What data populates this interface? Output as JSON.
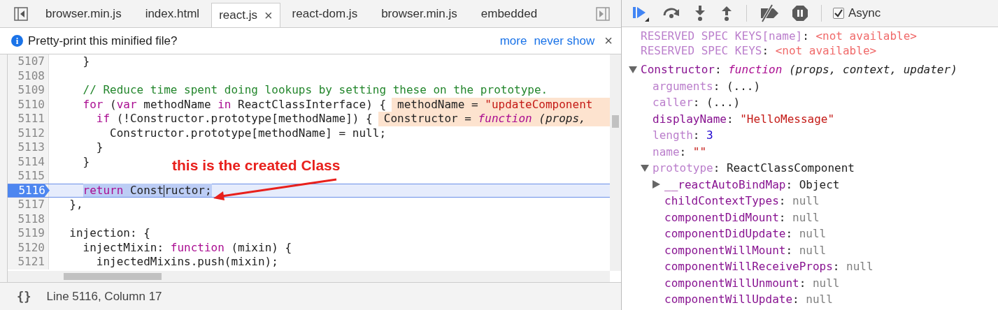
{
  "tabs": [
    {
      "label": "browser.min.js",
      "selected": false
    },
    {
      "label": "index.html",
      "selected": false
    },
    {
      "label": "react.js",
      "selected": true,
      "close": "×"
    },
    {
      "label": "react-dom.js",
      "selected": false
    },
    {
      "label": "browser.min.js",
      "selected": false
    },
    {
      "label": "embedded",
      "selected": false
    }
  ],
  "infobar": {
    "icon": "i",
    "message": "Pretty-print this minified file?",
    "links": [
      "more",
      "never show"
    ],
    "close": "×"
  },
  "code": {
    "lines": [
      {
        "number": "5107",
        "current": false,
        "tokens": [
          {
            "kind": "plain",
            "text": "    }"
          }
        ]
      },
      {
        "number": "5108",
        "current": false
      },
      {
        "number": "5109",
        "current": false,
        "tokens": [
          {
            "kind": "comment",
            "text": "    // Reduce time spent doing lookups by setting these on the prototype."
          }
        ]
      },
      {
        "number": "5110",
        "current": false,
        "tokens": [
          {
            "kind": "keyword",
            "text": "    for"
          },
          {
            "kind": "plain",
            "text": " ("
          },
          {
            "kind": "keyword",
            "text": "var"
          },
          {
            "kind": "plain",
            "text": " methodName "
          },
          {
            "kind": "keyword",
            "text": "in"
          },
          {
            "kind": "plain",
            "text": " ReactClassInterface) {"
          }
        ],
        "inline_value": [
          {
            "kind": "plain",
            "text": "methodName = "
          },
          {
            "kind": "string",
            "text": "\"updateComponent"
          }
        ]
      },
      {
        "number": "5111",
        "current": false,
        "tokens": [
          {
            "kind": "keyword",
            "text": "      if"
          },
          {
            "kind": "plain",
            "text": " (!Constructor.prototype[methodName]) {"
          }
        ],
        "inline_value": [
          {
            "kind": "plain",
            "text": "Constructor = "
          },
          {
            "kind": "fn",
            "text": "function"
          },
          {
            "kind": "params",
            "text": " (props,"
          }
        ]
      },
      {
        "number": "5112",
        "current": false,
        "tokens": [
          {
            "kind": "plain",
            "text": "        Constructor.prototype[methodName] = null;"
          }
        ]
      },
      {
        "number": "5113",
        "current": false,
        "tokens": [
          {
            "kind": "plain",
            "text": "      }"
          }
        ]
      },
      {
        "number": "5114",
        "current": false,
        "tokens": [
          {
            "kind": "plain",
            "text": "    }"
          }
        ]
      },
      {
        "number": "5115",
        "current": false
      },
      {
        "number": "5116",
        "current": true,
        "selection": [
          {
            "kind": "keyword",
            "text": "    return"
          },
          {
            "kind": "plain",
            "text": " Const"
          },
          {
            "kind": "caret"
          },
          {
            "kind": "plain",
            "text": "ructor;"
          }
        ]
      },
      {
        "number": "5117",
        "current": false,
        "tokens": [
          {
            "kind": "plain",
            "text": "  },"
          }
        ]
      },
      {
        "number": "5118",
        "current": false
      },
      {
        "number": "5119",
        "current": false,
        "tokens": [
          {
            "kind": "plain",
            "text": "  injection: {"
          }
        ]
      },
      {
        "number": "5120",
        "current": false,
        "tokens": [
          {
            "kind": "plain",
            "text": "    injectMixin: "
          },
          {
            "kind": "keyword",
            "text": "function"
          },
          {
            "kind": "plain",
            "text": " (mixin) {"
          }
        ]
      },
      {
        "number": "5121",
        "current": false,
        "tokens": [
          {
            "kind": "plain",
            "text": "      injectedMixins.push(mixin);"
          }
        ]
      }
    ],
    "callout": {
      "text": "this is the created Class"
    }
  },
  "status_bar": {
    "format_icon": "{}",
    "position": "Line 5116, Column 17"
  },
  "toolbar": {
    "async": {
      "label": "Async",
      "checked": true
    }
  },
  "scope": [
    {
      "name": "RESERVED SPEC KEYS[name]",
      "sep": ":",
      "dimmed": true,
      "kind": "unavailable",
      "value": "<not available>"
    },
    {
      "name": "RESERVED SPEC KEYS",
      "sep": ":",
      "dimmed": true,
      "kind": "unavailable",
      "value": "<not available>"
    },
    {
      "name": "Constructor",
      "sep": ":",
      "dimmed": false,
      "kind": "function",
      "keyword": "function",
      "value": "(props, context, updater)",
      "expanded": true,
      "children": [
        {
          "name": "arguments",
          "sep": ":",
          "dimmed": true,
          "kind": "plain",
          "value": "(...)"
        },
        {
          "name": "caller",
          "sep": ":",
          "dimmed": true,
          "kind": "plain",
          "value": "(...)"
        },
        {
          "name": "displayName",
          "sep": ":",
          "dimmed": false,
          "kind": "string",
          "value": "\"HelloMessage\""
        },
        {
          "name": "length",
          "sep": ":",
          "dimmed": true,
          "kind": "number",
          "value": "3"
        },
        {
          "name": "name",
          "sep": ":",
          "dimmed": true,
          "kind": "string",
          "value": "\"\""
        },
        {
          "name": "prototype",
          "sep": ":",
          "dimmed": true,
          "kind": "plain",
          "value": "ReactClassComponent",
          "expanded": true,
          "children": [
            {
              "name": "__reactAutoBindMap",
              "sep": ":",
              "dimmed": false,
              "kind": "plain",
              "value": "Object",
              "expanded": false
            },
            {
              "name": "childContextTypes",
              "sep": ":",
              "dimmed": false,
              "kind": "null",
              "value": "null"
            },
            {
              "name": "componentDidMount",
              "sep": ":",
              "dimmed": false,
              "kind": "null",
              "value": "null"
            },
            {
              "name": "componentDidUpdate",
              "sep": ":",
              "dimmed": false,
              "kind": "null",
              "value": "null"
            },
            {
              "name": "componentWillMount",
              "sep": ":",
              "dimmed": false,
              "kind": "null",
              "value": "null"
            },
            {
              "name": "componentWillReceiveProps",
              "sep": ":",
              "dimmed": false,
              "kind": "null",
              "value": "null"
            },
            {
              "name": "componentWillUnmount",
              "sep": ":",
              "dimmed": false,
              "kind": "null",
              "value": "null"
            },
            {
              "name": "componentWillUpdate",
              "sep": ":",
              "dimmed": false,
              "kind": "null",
              "value": "null"
            }
          ]
        }
      ]
    }
  ]
}
